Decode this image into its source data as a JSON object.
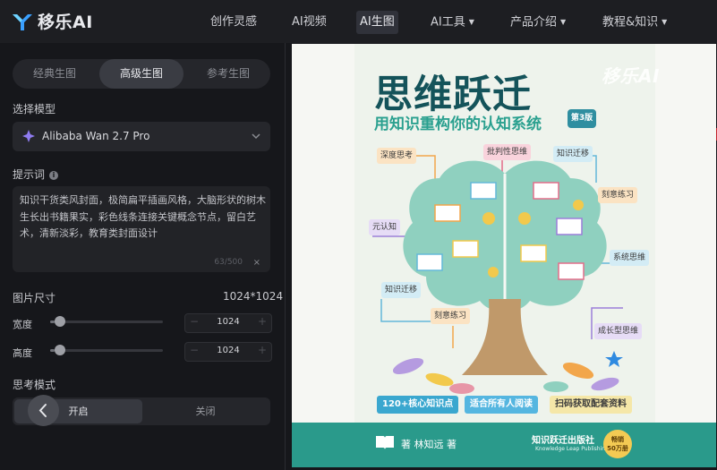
{
  "header": {
    "brand": "移乐AI",
    "nav": [
      {
        "label": "创作灵感",
        "has_menu": false
      },
      {
        "label": "AI视频",
        "has_menu": false
      },
      {
        "label": "AI生图",
        "has_menu": false,
        "active": true
      },
      {
        "label": "AI工具",
        "has_menu": true
      },
      {
        "label": "产品介绍",
        "has_menu": true
      },
      {
        "label": "教程&知识",
        "has_menu": true
      }
    ],
    "caret": "▼"
  },
  "panel": {
    "tabs": [
      {
        "label": "经典生图"
      },
      {
        "label": "高级生图",
        "active": true
      },
      {
        "label": "参考生图"
      }
    ],
    "model": {
      "label": "选择模型",
      "value": "Alibaba Wan 2.7 Pro"
    },
    "prompt": {
      "label": "提示词",
      "info": "i",
      "text": "知识干货类风封面，极简扁平插画风格，大脑形状的树木生长出书籍果实，彩色线条连接关键概念节点，留白艺术，清新淡彩，教育类封面设计",
      "count": "63/500",
      "clear": "×"
    },
    "size": {
      "label": "图片尺寸",
      "value": "1024*1024",
      "width": {
        "label": "宽度",
        "value": "1024",
        "level": 0.04
      },
      "height": {
        "label": "高度",
        "value": "1024",
        "level": 0.04
      },
      "minus": "−",
      "plus": "+"
    },
    "thinking": {
      "label": "思考模式",
      "on": "开启",
      "off": "关闭"
    }
  },
  "cover": {
    "title": "思维跃迁",
    "subtitle": "用知识重构你的认知系统",
    "edition": "第3版",
    "watermark": "移乐AI",
    "tags": [
      "深度思考",
      "批判性思维",
      "知识迁移",
      "刻意练习",
      "元认知",
      "系统思维",
      "知识迁移",
      "刻意练习",
      "成长型思维"
    ],
    "pills": [
      "120+核心知识点",
      "适合所有人阅读",
      "扫码获取配套资料"
    ],
    "author": "著  林知远  著",
    "publisher": "知识跃迁出版社",
    "publisher_en": "Knowledge Leap Publishing",
    "badge_line1": "畅销",
    "badge_line2": "50万册"
  },
  "colors": {
    "accent": "#2a9a8b",
    "title": "#14535a",
    "tree": "#8fd0bf",
    "trunk": "#c0996a"
  }
}
